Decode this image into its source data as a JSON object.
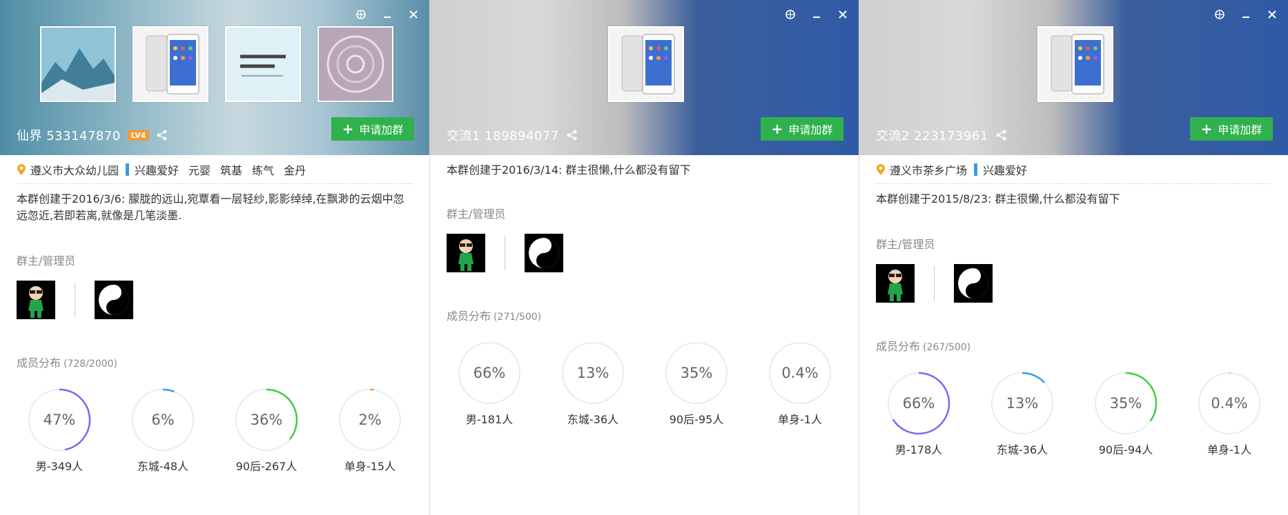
{
  "panels": [
    {
      "title": "仙界 533147870",
      "level": "LV4",
      "join_label": "申请加群",
      "location": "遵义市大众幼儿园",
      "tags": [
        "兴趣爱好",
        "元婴",
        "筑基",
        "练气",
        "金丹"
      ],
      "description": "本群创建于2016/3/6:  朦胧的远山,宛覃看一层轻纱,影影绰绰,在飘渺的云烟中忽远忽近,若即若离,就像是几笔淡墨.",
      "admins_title": "群主/管理员",
      "members_title": "成员分布",
      "members_count": "(728/2000)",
      "stats": [
        {
          "pct": "47%",
          "value": 0.47,
          "label": "男-349人",
          "color": "#7b68ee"
        },
        {
          "pct": "6%",
          "value": 0.06,
          "label": "东城-48人",
          "color": "#3a9be3"
        },
        {
          "pct": "36%",
          "value": 0.36,
          "label": "90后-267人",
          "color": "#3cd03c"
        },
        {
          "pct": "2%",
          "value": 0.02,
          "label": "单身-15人",
          "color": "#f0a020"
        }
      ]
    },
    {
      "title": "交流1 189894077",
      "join_label": "申请加群",
      "description": "本群创建于2016/3/14:  群主很懒,什么都没有留下",
      "admins_title": "群主/管理员",
      "members_title": "成员分布",
      "members_count": "(271/500)",
      "stats": [
        {
          "pct": "66%",
          "value": 0,
          "label": "男-181人",
          "color": "#7b68ee"
        },
        {
          "pct": "13%",
          "value": 0,
          "label": "东城-36人",
          "color": "#3a9be3"
        },
        {
          "pct": "35%",
          "value": 0,
          "label": "90后-95人",
          "color": "#3cd03c"
        },
        {
          "pct": "0.4%",
          "value": 0,
          "label": "单身-1人",
          "color": "#f0a020"
        }
      ]
    },
    {
      "title": "交流2 223173961",
      "join_label": "申请加群",
      "location": "遵义市茶乡广场",
      "tags": [
        "兴趣爱好"
      ],
      "description": "本群创建于2015/8/23:  群主很懒,什么都没有留下",
      "admins_title": "群主/管理员",
      "members_title": "成员分布",
      "members_count": "(267/500)",
      "stats": [
        {
          "pct": "66%",
          "value": 0.66,
          "label": "男-178人",
          "color": "#7b68ee"
        },
        {
          "pct": "13%",
          "value": 0.13,
          "label": "东城-36人",
          "color": "#3a9be3"
        },
        {
          "pct": "35%",
          "value": 0.35,
          "label": "90后-94人",
          "color": "#3cd03c"
        },
        {
          "pct": "0.4%",
          "value": 0.004,
          "label": "单身-1人",
          "color": "#f0a020"
        }
      ]
    }
  ],
  "colors": {
    "join_button": "#2fb24e",
    "level_badge": "#f39a2d",
    "tag_marker": "#3a9be3",
    "location_pin": "#f5a623",
    "ring_track": "#e3eef3"
  }
}
